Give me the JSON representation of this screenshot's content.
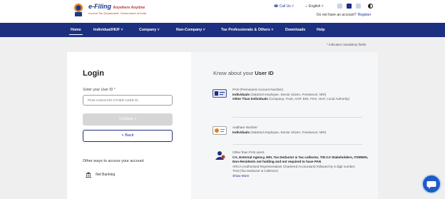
{
  "header": {
    "logo_title": "e-Filing",
    "logo_tagline": "Anywhere Anytime",
    "logo_sub": "Income Tax Department, Government of India",
    "call_us": "Call Us",
    "language": "English",
    "no_account": "Do not have an account?",
    "register": "Register"
  },
  "nav": {
    "items": [
      {
        "label": "Home"
      },
      {
        "label": "Individual/HUF ˅"
      },
      {
        "label": "Company ˅"
      },
      {
        "label": "Non-Company ˅"
      },
      {
        "label": "Tax Professionals & Others ˅"
      },
      {
        "label": "Downloads"
      },
      {
        "label": "Help"
      }
    ]
  },
  "mandatory_note": "* Indicates mandatory fields",
  "login": {
    "title": "Login",
    "field_label": "Enter your User ID",
    "required_mark": "*",
    "placeholder": "PAN/ AADHAAR/ OTHER USER ID",
    "continue_label": "Continue >",
    "back_label": "< Back",
    "other_ways": "Other ways to access your account",
    "net_banking": "Net Banking"
  },
  "know": {
    "title_prefix": "Know about your",
    "title_bold": "User ID",
    "pan": {
      "heading": "PAN (Permanent Account Number)",
      "individuals_label": "Individuals",
      "individuals_text": "(Salaried employee, Senior citizen, Freelancer, NRI)",
      "others_label": "Other Than Individuals",
      "others_text": "(Company, Trust, AOP, BOI, Firm, HUF, Local Authority)"
    },
    "aadhaar": {
      "heading": "Aadhaar Number",
      "individuals_label": "Individuals",
      "individuals_text": "(Salaried employee, Senior citizen, Freelancer, NRI)"
    },
    "other": {
      "heading": "Other than PAN users",
      "line1": "CA, External Agency, ERI, Tax Deductor & Tax collector, TIN 2.0 Stakeholders, ITDREIN, Non-Residents not holding and not required to have PAN",
      "line2": "ARCA (Authorised Representative Chartered Accountant) followed by 6 digit number,",
      "line3": "TAN (Tax Deductor & Collector)",
      "show_more": "Show More"
    }
  },
  "colors": {
    "nav_bg": "#1d2f80",
    "link": "#1d2f80",
    "chat": "#1e5bc6"
  }
}
